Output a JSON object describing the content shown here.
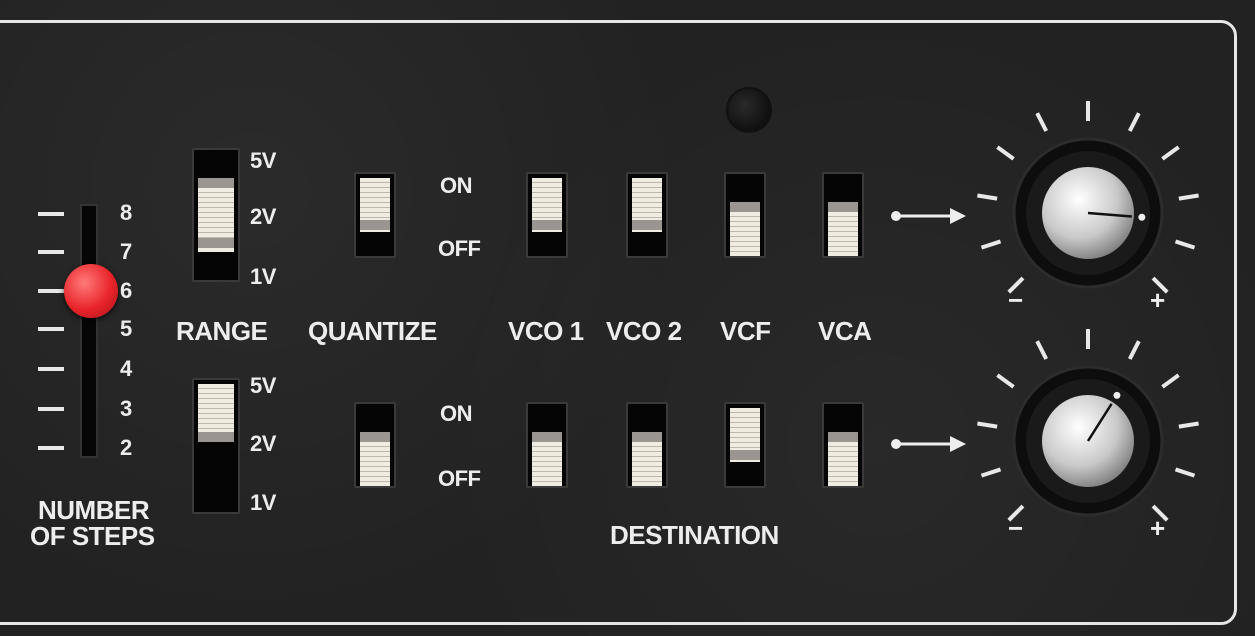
{
  "steps": {
    "title_line1": "NUMBER",
    "title_line2": "OF STEPS",
    "labels": [
      "8",
      "7",
      "6",
      "5",
      "4",
      "3",
      "2"
    ],
    "selected": "6"
  },
  "range": {
    "label": "RANGE",
    "upper_options": [
      "5V",
      "2V",
      "1V"
    ],
    "lower_options": [
      "5V",
      "2V",
      "1V"
    ]
  },
  "quantize": {
    "label": "QUANTIZE",
    "on_label": "ON",
    "off_label": "OFF",
    "on_label_2": "ON",
    "off_label_2": "OFF",
    "upper_state": "ON",
    "lower_state": "OFF"
  },
  "destination": {
    "label": "DESTINATION",
    "targets": [
      "VCO 1",
      "VCO 2",
      "VCF",
      "VCA"
    ],
    "upper_states": [
      "ON",
      "ON",
      "OFF",
      "OFF"
    ],
    "lower_states": [
      "OFF",
      "OFF",
      "ON",
      "OFF"
    ]
  },
  "knobs": {
    "minus": "−",
    "plus": "+",
    "upper_level": 0.85,
    "lower_level": 0.62
  },
  "colors": {
    "panel": "#222222",
    "ivory": "#f1ece1",
    "slider_handle": "#e8242a",
    "outline": "#e6e6e6"
  }
}
